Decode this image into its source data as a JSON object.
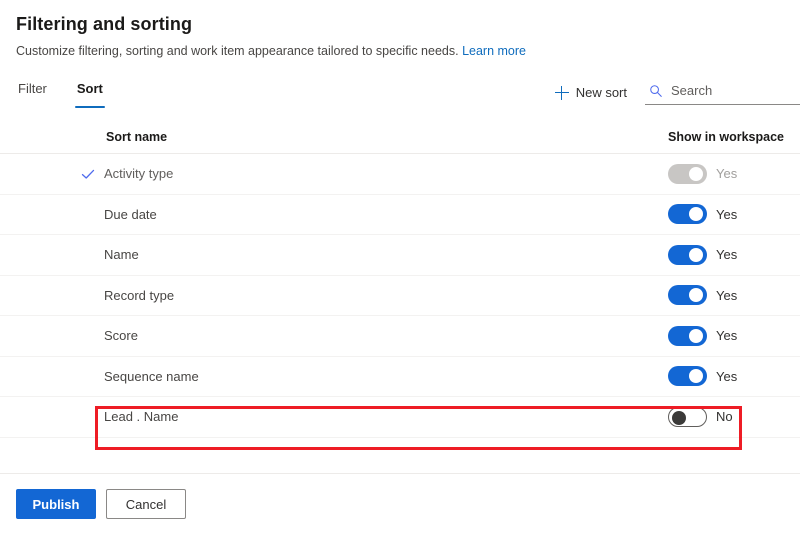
{
  "header": {
    "title": "Filtering and sorting",
    "subtitle": "Customize filtering, sorting and work item appearance tailored to specific needs.",
    "learn_more": "Learn more"
  },
  "toolbar": {
    "tabs": [
      {
        "label": "Filter",
        "active": false
      },
      {
        "label": "Sort",
        "active": true
      }
    ],
    "new_sort_label": "New sort",
    "plus_icon": "plus-icon",
    "search": {
      "icon": "search-icon",
      "placeholder": "Search",
      "value": ""
    }
  },
  "table": {
    "columns": {
      "name": "Sort name",
      "toggle": "Show in workspace"
    },
    "rows": [
      {
        "name": "Activity type",
        "checked": true,
        "toggle_state": "disabled",
        "toggle_label": "Yes",
        "highlighted": false
      },
      {
        "name": "Due date",
        "checked": false,
        "toggle_state": "on",
        "toggle_label": "Yes",
        "highlighted": false
      },
      {
        "name": "Name",
        "checked": false,
        "toggle_state": "on",
        "toggle_label": "Yes",
        "highlighted": false
      },
      {
        "name": "Record type",
        "checked": false,
        "toggle_state": "on",
        "toggle_label": "Yes",
        "highlighted": false
      },
      {
        "name": "Score",
        "checked": false,
        "toggle_state": "on",
        "toggle_label": "Yes",
        "highlighted": false
      },
      {
        "name": "Sequence name",
        "checked": false,
        "toggle_state": "on",
        "toggle_label": "Yes",
        "highlighted": false
      },
      {
        "name": "Lead . Name",
        "checked": false,
        "toggle_state": "off",
        "toggle_label": "No",
        "highlighted": true
      }
    ]
  },
  "footer": {
    "publish_label": "Publish",
    "cancel_label": "Cancel"
  },
  "colors": {
    "accent": "#0f6cbd",
    "toggle_on": "#1367d4",
    "toggle_disabled": "#c8c6c4",
    "highlight": "#ee1c25",
    "link": "#0f6cbd"
  }
}
